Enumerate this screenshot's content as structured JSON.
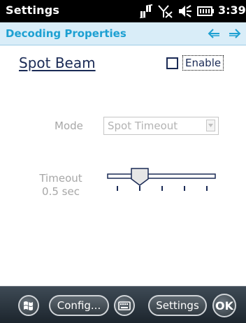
{
  "statusbar": {
    "title": "Settings",
    "time": "3:39",
    "icons": [
      "connectivity-icon",
      "signal-off-icon",
      "volume-icon",
      "battery-icon"
    ]
  },
  "subheader": {
    "heading": "Decoding Properties",
    "prev_icon": "arrow-left-icon",
    "next_icon": "arrow-right-icon",
    "accent_color": "#1da0d2"
  },
  "content": {
    "section_title": "Spot Beam",
    "enable_label": "Enable",
    "enable_checked": false,
    "mode_label": "Mode",
    "mode_value": "Spot Timeout",
    "timeout_label_line1": "Timeout",
    "timeout_label_line2": "0.5 sec",
    "timeout_slider": {
      "position": 1,
      "steps": 5
    }
  },
  "taskbar": {
    "start_icon": "windows-start-icon",
    "config_label": "Config...",
    "keyboard_icon": "keyboard-icon",
    "settings_label": "Settings",
    "ok_label": "OK"
  }
}
